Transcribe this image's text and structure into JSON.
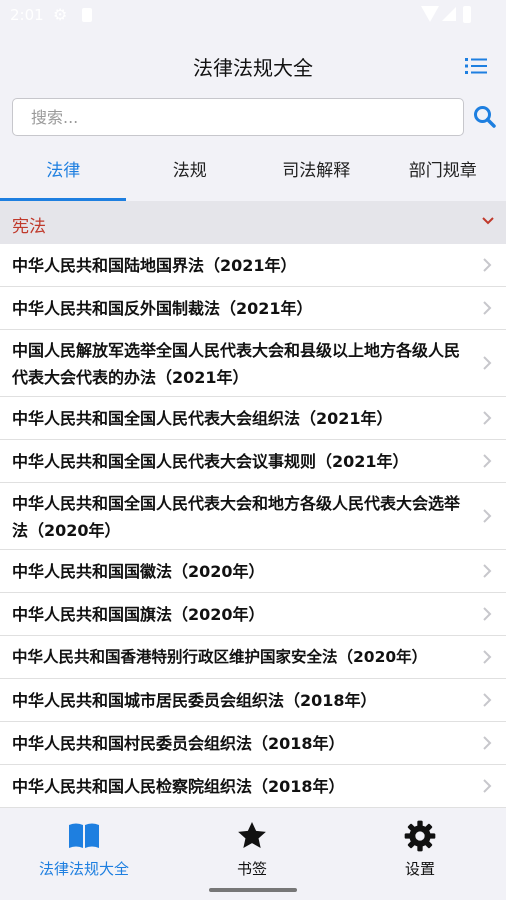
{
  "status": {
    "time": "2:01"
  },
  "header": {
    "title": "法律法规大全"
  },
  "search": {
    "placeholder": "搜索..."
  },
  "tabs": [
    {
      "label": "法律"
    },
    {
      "label": "法规"
    },
    {
      "label": "司法解释"
    },
    {
      "label": "部门规章"
    }
  ],
  "section": {
    "label": "宪法"
  },
  "items": [
    {
      "title": "中华人民共和国陆地国界法（2021年）"
    },
    {
      "title": "中华人民共和国反外国制裁法（2021年）"
    },
    {
      "title": "中国人民解放军选举全国人民代表大会和县级以上地方各级人民代表大会代表的办法（2021年）"
    },
    {
      "title": "中华人民共和国全国人民代表大会组织法（2021年）"
    },
    {
      "title": "中华人民共和国全国人民代表大会议事规则（2021年）"
    },
    {
      "title": "中华人民共和国全国人民代表大会和地方各级人民代表大会选举法（2020年）"
    },
    {
      "title": "中华人民共和国国徽法（2020年）"
    },
    {
      "title": "中华人民共和国国旗法（2020年）"
    },
    {
      "title": "中华人民共和国香港特别行政区维护国家安全法（2020年）"
    },
    {
      "title": "中华人民共和国城市居民委员会组织法（2018年）"
    },
    {
      "title": "中华人民共和国村民委员会组织法（2018年）"
    },
    {
      "title": "中华人民共和国人民检察院组织法（2018年）"
    }
  ],
  "bottom_nav": [
    {
      "label": "法律法规大全"
    },
    {
      "label": "书签"
    },
    {
      "label": "设置"
    }
  ],
  "colors": {
    "accent": "#1e7fe0",
    "section_text": "#c0392b"
  }
}
